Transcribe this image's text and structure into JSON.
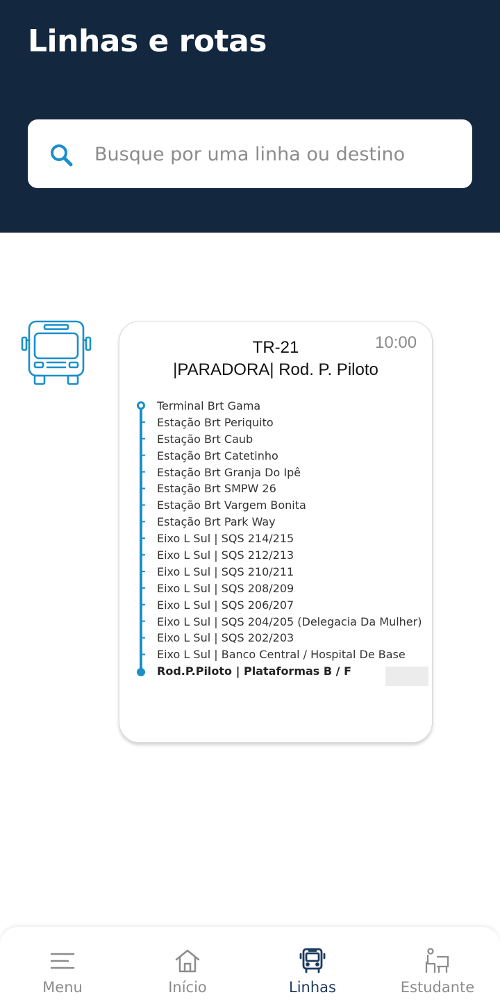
{
  "header": {
    "title": "Linhas e rotas"
  },
  "search": {
    "placeholder": "Busque por uma linha ou destino",
    "value": ""
  },
  "route": {
    "code": "TR-21",
    "name": "|PARADORA| Rod. P. Piloto",
    "time": "10:00",
    "stops": [
      "Terminal Brt Gama",
      "Estação Brt Periquito",
      "Estação Brt Caub",
      "Estação Brt Catetinho",
      "Estação Brt Granja Do Ipê",
      "Estação Brt SMPW 26",
      "Estação Brt Vargem Bonita",
      "Estação Brt Park Way",
      "Eixo L Sul | SQS 214/215",
      "Eixo L Sul | SQS 212/213",
      "Eixo L Sul | SQS 210/211",
      "Eixo L Sul | SQS 208/209",
      "Eixo L Sul | SQS 206/207",
      "Eixo L Sul | SQS 204/205 (Delegacia Da Mulher)",
      "Eixo L Sul | SQS 202/203",
      "Eixo L Sul | Banco Central / Hospital De Base",
      "Rod.P.Piloto | Plataformas B / F"
    ]
  },
  "nav": {
    "items": [
      {
        "label": "Menu",
        "icon": "menu-icon"
      },
      {
        "label": "Início",
        "icon": "home-icon"
      },
      {
        "label": "Linhas",
        "icon": "bus-icon",
        "active": true
      },
      {
        "label": "Estudante",
        "icon": "student-icon"
      }
    ]
  },
  "colors": {
    "header_bg": "#13283f",
    "accent": "#1a8fc9",
    "nav_active": "#1d3a5f",
    "nav_inactive": "#8c8c8c"
  }
}
